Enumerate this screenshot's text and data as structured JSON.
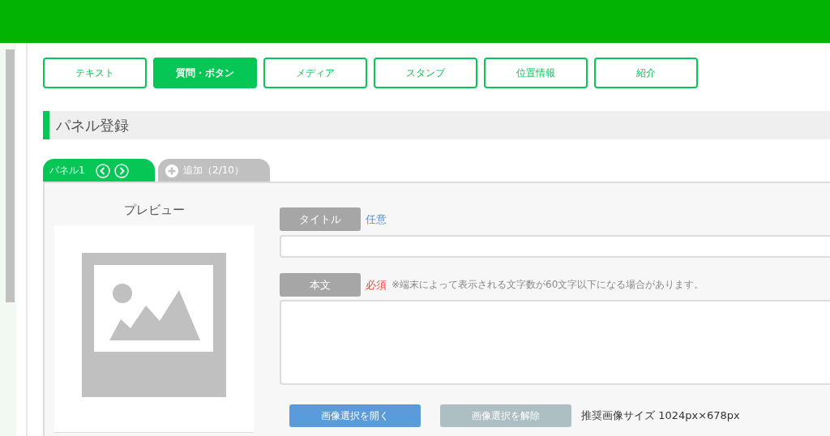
{
  "tabs": [
    {
      "label": "テキスト",
      "selected": false
    },
    {
      "label": "質問・ボタン",
      "selected": true
    },
    {
      "label": "メディア",
      "selected": false
    },
    {
      "label": "スタンプ",
      "selected": false
    },
    {
      "label": "位置情報",
      "selected": false
    },
    {
      "label": "紹介",
      "selected": false
    }
  ],
  "section_title": "パネル登録",
  "panel_tabs": [
    {
      "kind": "panel",
      "label": "パネル1",
      "selected": true
    },
    {
      "kind": "add",
      "label": "追加（2/10）",
      "selected": false
    }
  ],
  "preview": {
    "label": "プレビュー"
  },
  "fields": [
    {
      "kind": "input",
      "label": "タイトル",
      "badge": "任意",
      "required": false
    },
    {
      "kind": "textarea",
      "label": "本文",
      "badge": "必須",
      "required": true,
      "note": "※端末によって表示される文字数が60文字以下になる場合があります。"
    }
  ],
  "image_buttons": [
    {
      "label": "画像選択を開く",
      "disabled": false
    },
    {
      "label": "画像選択を解除",
      "disabled": true
    }
  ],
  "image_size_note": "推奨画像サイズ 1024px×678px"
}
